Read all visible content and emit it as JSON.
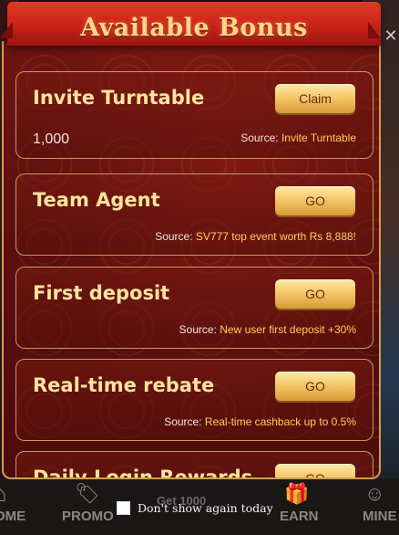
{
  "modal": {
    "title": "Available Bonus",
    "close_icon": "close-icon"
  },
  "bonuses": [
    {
      "title": "Invite Turntable",
      "button": "Claim",
      "amount": "1,000",
      "source_label": "Source:",
      "source_value": "Invite Turntable"
    },
    {
      "title": "Team Agent",
      "button": "GO",
      "source_label": "Source:",
      "source_value": "SV777 top event worth Rs 8,888!"
    },
    {
      "title": "First deposit",
      "button": "GO",
      "source_label": "Source:",
      "source_value": "New user first deposit +30%"
    },
    {
      "title": "Real-time rebate",
      "button": "GO",
      "source_label": "Source:",
      "source_value": "Real-time cashback up to 0.5%"
    },
    {
      "title": "Daily Login Rewards",
      "button": "GO"
    }
  ],
  "footer": {
    "dont_show_label": "Don't show again today",
    "checked": false
  },
  "bottom_nav": {
    "home": "OME",
    "promo": "PROMO",
    "earn": "EARN",
    "mine": "MINE",
    "center_text": "Get 1000"
  },
  "colors": {
    "modal_bg": "#5a0f0c",
    "ribbon": "#c9221a",
    "title_gold": "#ffd58a",
    "card_border": "#c59a5b",
    "button_gold": "#f4c86a",
    "source_accent": "#ffcf5a"
  }
}
